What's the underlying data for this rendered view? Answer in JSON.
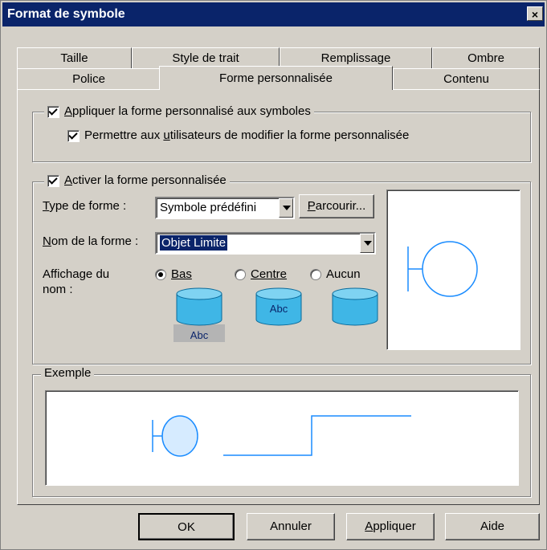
{
  "window": {
    "title": "Format de symbole",
    "close": "×"
  },
  "tabs_back": [
    "Taille",
    "Style de trait",
    "Remplissage",
    "Ombre"
  ],
  "tabs_front": [
    "Police",
    "Forme personnalisée",
    "Contenu"
  ],
  "active_tab": "Forme personnalisée",
  "apply_group": {
    "apply_label_key": "A",
    "apply_label_rest": "ppliquer la forme personnalisé aux symboles",
    "allow_label_pre": "Permettre aux ",
    "allow_label_key": "u",
    "allow_label_rest": "tilisateurs de modifier la forme personnalisée"
  },
  "custom_group": {
    "activate_key": "A",
    "activate_rest": "ctiver la forme personnalisée",
    "type_label_key": "T",
    "type_label_rest": "ype de forme :",
    "type_value": "Symbole prédéfini",
    "browse_key": "P",
    "browse_rest": "arcourir...",
    "name_label_key": "N",
    "name_label_rest": "om de la forme :",
    "name_value": "Objet Limite",
    "display_label": "Affichage du nom :",
    "radio_bottom": "Bas",
    "radio_center": "Centre",
    "radio_none": "Aucun",
    "abc": "Abc"
  },
  "example_group": {
    "title": "Exemple"
  },
  "buttons": {
    "ok": "OK",
    "cancel": "Annuler",
    "apply_key": "A",
    "apply_rest": "ppliquer",
    "help": "Aide"
  },
  "colors": {
    "title_bar": "#0a246a",
    "shape_stroke": "#1a8cff",
    "shape_fill": "#d6ebff",
    "cylinder": "#3fb6e6"
  }
}
